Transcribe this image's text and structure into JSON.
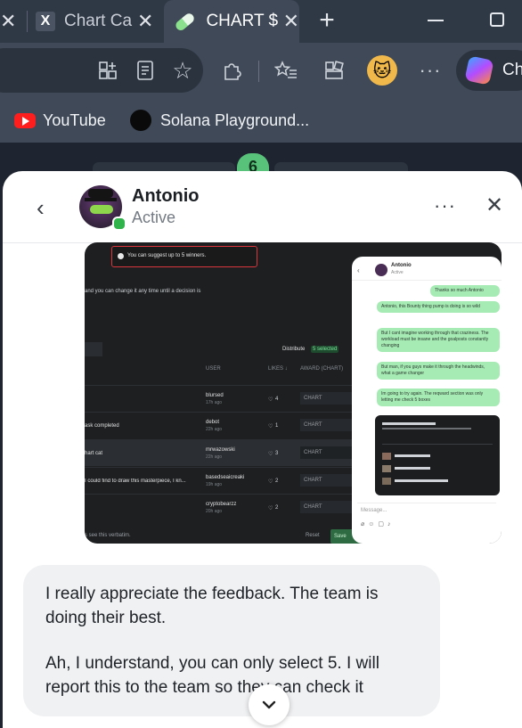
{
  "tabs": [
    {
      "label": "Chart Ca",
      "icon": "x-logo-icon"
    },
    {
      "label": "CHART $",
      "icon": "pill-icon"
    }
  ],
  "bookmarks": [
    {
      "label": "YouTube",
      "icon": "youtube-icon"
    },
    {
      "label": "Solana Playground...",
      "icon": "solana-icon"
    }
  ],
  "toolbar": {
    "copilot_label": "Ch",
    "notification_count": "6"
  },
  "chat": {
    "contact_name": "Antonio",
    "contact_status": "Active",
    "shared_image": {
      "banner": "You can suggest up to 5 winners.",
      "left_text": "and you can change it any time until a decision is",
      "distribute_label": "Distribute",
      "distribute_badge": "5 selected",
      "columns": [
        "USER",
        "LIKES ↓",
        "AWARD (CHART)"
      ],
      "rows": [
        {
          "user": "blursed",
          "time": "17h ago",
          "likes": "4",
          "award": "CHART",
          "left": ""
        },
        {
          "user": "debot",
          "time": "22h ago",
          "likes": "1",
          "award": "CHART",
          "left": "ask completed"
        },
        {
          "user": "mrwazowski",
          "time": "22h ago",
          "likes": "3",
          "award": "CHART",
          "left": "hart cat"
        },
        {
          "user": "basedseaicreaki",
          "time": "19h ago",
          "likes": "2",
          "award": "CHART",
          "left": "I could find to draw this masterpiece, I kn..."
        },
        {
          "user": "cryptobearzz",
          "time": "20h ago",
          "likes": "2",
          "award": "CHART",
          "left": ""
        }
      ],
      "footer_left": "s see this verbatim.",
      "reset_label": "Reset",
      "save_label": "Save",
      "mini_chat": {
        "name": "Antonio",
        "status": "Active",
        "messages": [
          "Thanks so much Antonio",
          "Antonio, this Bounty thing pump is doing is so wild",
          "But I cant imagine working through that craziness. The workload must be insane and the goalposts constantly changing",
          "But man, if you guys make it through the headwinds, what a game changer",
          "Im going to try again. The reqward section was only letting me check 5 boxes"
        ],
        "input_placeholder": "Message..."
      }
    },
    "messages": [
      "I really appreciate the feedback. The team is doing their best.",
      "Ah, I understand, you can only select 5. I will report this to the team so they can check it"
    ]
  }
}
